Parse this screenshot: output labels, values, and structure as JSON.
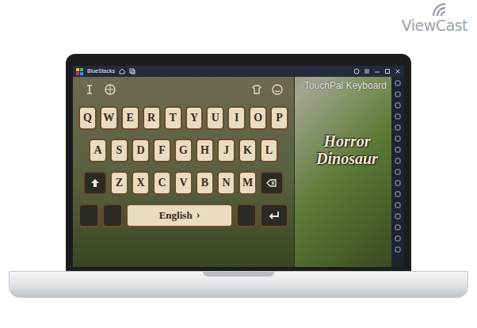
{
  "watermark": {
    "logo": "ViewCast"
  },
  "window": {
    "title": "BlueStacks"
  },
  "promo": {
    "brand": "TouchPal Keyboard",
    "theme_title": "Horror Dinosaur"
  },
  "keyboard": {
    "rows": [
      [
        "Q",
        "W",
        "E",
        "R",
        "T",
        "Y",
        "U",
        "I",
        "O",
        "P"
      ],
      [
        "A",
        "S",
        "D",
        "F",
        "G",
        "H",
        "J",
        "K",
        "L"
      ],
      [
        "Z",
        "X",
        "C",
        "V",
        "B",
        "N",
        "M"
      ]
    ],
    "language": "English",
    "language_arrow": "›"
  }
}
